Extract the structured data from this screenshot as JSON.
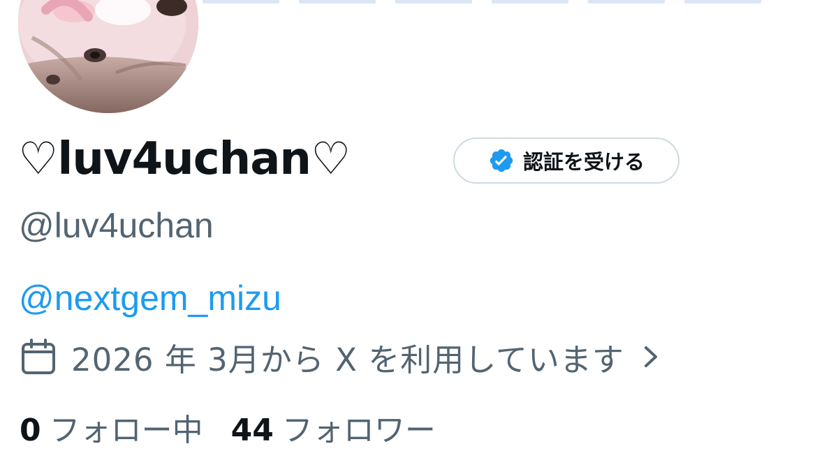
{
  "profile": {
    "display_name": "♡luv4uchan♡",
    "handle": "@luv4uchan",
    "bio_link": "@nextgem_mizu",
    "joined": "2026 年 3月から X を利用しています"
  },
  "verify_button": {
    "label": "認証を受ける",
    "icon": "verified-badge-icon"
  },
  "stats": {
    "following_count": "0",
    "following_label": "フォロー中",
    "followers_count": "44",
    "followers_label": "フォロワー"
  },
  "colors": {
    "text_primary": "#0f1419",
    "text_secondary": "#536471",
    "link": "#1d9bf0",
    "border": "#cfd9de"
  }
}
